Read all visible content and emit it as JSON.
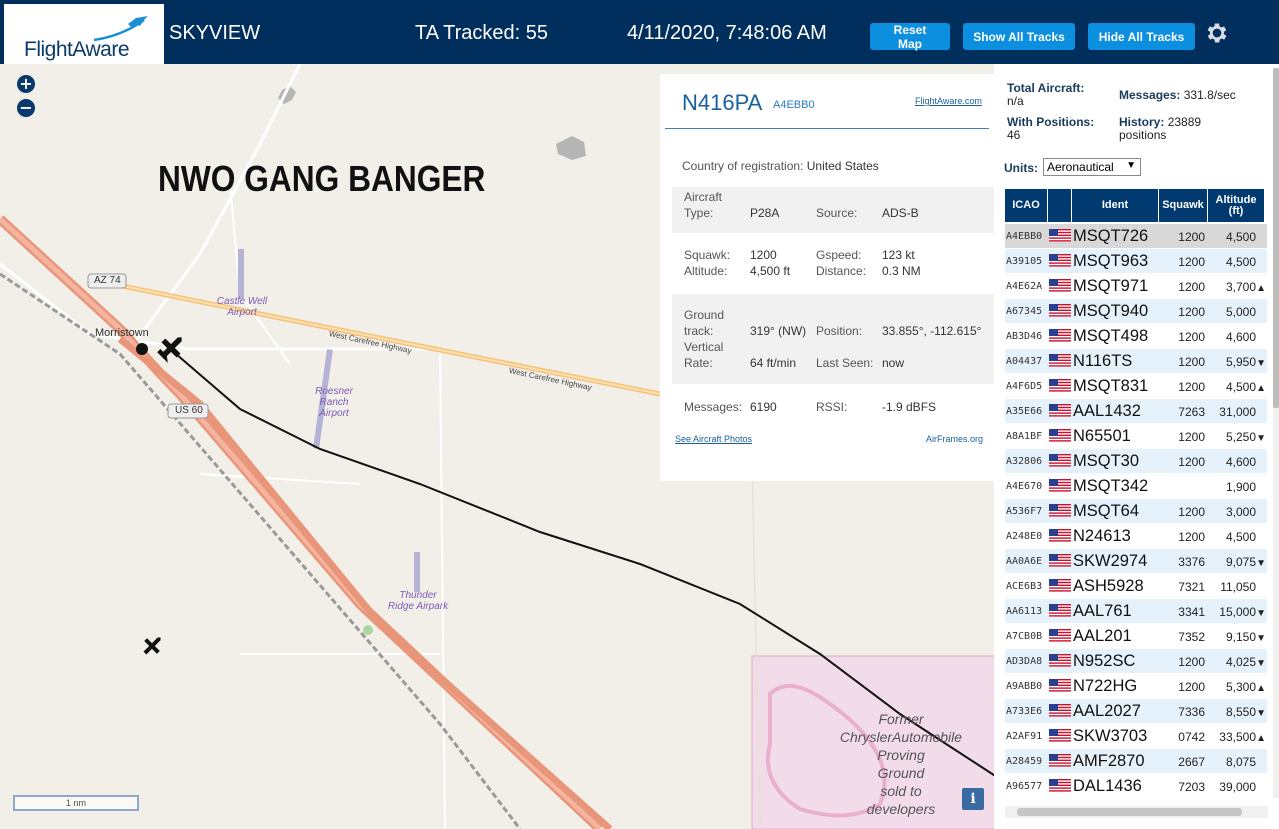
{
  "header": {
    "logo": "FlightAware",
    "app_title": "SKYVIEW",
    "ta_tracked": "TA Tracked: 55",
    "clock": "4/11/2020, 7:48:06 AM",
    "reset_label": "Reset Map",
    "show_all_label": "Show All Tracks",
    "hide_all_label": "Hide All Tracks",
    "settings_icon": "gear-icon"
  },
  "map": {
    "zoom_in": "+",
    "zoom_out": "−",
    "overlay_text": "NWO GANG BANGER",
    "place_morristown": "Morristown",
    "road_az74": "AZ 74",
    "road_us60": "US 60",
    "road_carefree_1": "West Carefree Highway",
    "road_carefree_2": "West Carefree Highway",
    "airport_castle_well": "Castle Well\nAirport",
    "airport_roesner": "Roesner\nRanch\nAirport",
    "airport_thunder": "Thunder\nRidge Airpark",
    "former_text": "Former\nChryslerAutomobile\nProving\nGround\nsold to\ndevelopers",
    "scale": "1 nm",
    "info_button": "i"
  },
  "selected_aircraft": {
    "callsign": "N416PA",
    "hex": "A4EBB0",
    "fa_link": "FlightAware.com",
    "country_label": "Country of registration:",
    "country": "United States",
    "aircraft_label": "Aircraft",
    "type_label": "Type:",
    "type": "P28A",
    "source_label": "Source:",
    "source": "ADS-B",
    "squawk_label": "Squawk:",
    "squawk": "1200",
    "gspeed_label": "Gspeed:",
    "gspeed": "123 kt",
    "altitude_label": "Altitude:",
    "altitude": "4,500 ft",
    "distance_label": "Distance:",
    "distance": "0.3 NM",
    "ground_label": "Ground",
    "track_label": "track:",
    "track": "319° (NW)",
    "position_label": "Position:",
    "position": "33.855°, -112.615°",
    "vertical_label": "Vertical",
    "rate_label": "Rate:",
    "rate": "64 ft/min",
    "last_seen_label": "Last Seen:",
    "last_seen": "now",
    "messages_label": "Messages:",
    "messages": "6190",
    "rssi_label": "RSSI:",
    "rssi": "-1.9 dBFS",
    "photos_link": "See Aircraft Photos",
    "airframes_link": "AirFrames.org"
  },
  "stats": {
    "total_label": "Total Aircraft:",
    "total_value": "n/a",
    "messages_label": "Messages:",
    "messages_value": "331.8/sec",
    "positions_label": "With Positions:",
    "positions_value": "46",
    "history_label": "History:",
    "history_value": "23889",
    "history_unit": "positions",
    "units_label": "Units:",
    "units_value": "Aeronautical"
  },
  "table": {
    "headers": {
      "icao": "ICAO",
      "ident": "Ident",
      "squawk": "Squawk",
      "altitude": "Altitude\n(ft)"
    },
    "rows": [
      {
        "icao": "A4EBB0",
        "ident": "MSQT726",
        "squawk": "1200",
        "alt": "4,500",
        "arrow": ""
      },
      {
        "icao": "A39105",
        "ident": "MSQT963",
        "squawk": "1200",
        "alt": "4,500",
        "arrow": ""
      },
      {
        "icao": "A4E62A",
        "ident": "MSQT971",
        "squawk": "1200",
        "alt": "3,700",
        "arrow": "▲"
      },
      {
        "icao": "A67345",
        "ident": "MSQT940",
        "squawk": "1200",
        "alt": "5,000",
        "arrow": ""
      },
      {
        "icao": "AB3D46",
        "ident": "MSQT498",
        "squawk": "1200",
        "alt": "4,600",
        "arrow": ""
      },
      {
        "icao": "A04437",
        "ident": "N116TS",
        "squawk": "1200",
        "alt": "5,950",
        "arrow": "▼"
      },
      {
        "icao": "A4F6D5",
        "ident": "MSQT831",
        "squawk": "1200",
        "alt": "4,500",
        "arrow": "▲"
      },
      {
        "icao": "A35E66",
        "ident": "AAL1432",
        "squawk": "7263",
        "alt": "31,000",
        "arrow": ""
      },
      {
        "icao": "A8A1BF",
        "ident": "N65501",
        "squawk": "1200",
        "alt": "5,250",
        "arrow": "▼"
      },
      {
        "icao": "A32806",
        "ident": "MSQT30",
        "squawk": "1200",
        "alt": "4,600",
        "arrow": ""
      },
      {
        "icao": "A4E670",
        "ident": "MSQT342",
        "squawk": "",
        "alt": "1,900",
        "arrow": ""
      },
      {
        "icao": "A536F7",
        "ident": "MSQT64",
        "squawk": "1200",
        "alt": "3,000",
        "arrow": ""
      },
      {
        "icao": "A248E0",
        "ident": "N24613",
        "squawk": "1200",
        "alt": "4,500",
        "arrow": ""
      },
      {
        "icao": "AA0A6E",
        "ident": "SKW2974",
        "squawk": "3376",
        "alt": "9,075",
        "arrow": "▼"
      },
      {
        "icao": "ACE6B3",
        "ident": "ASH5928",
        "squawk": "7321",
        "alt": "11,050",
        "arrow": ""
      },
      {
        "icao": "AA6113",
        "ident": "AAL761",
        "squawk": "3341",
        "alt": "15,000",
        "arrow": "▼"
      },
      {
        "icao": "A7CB0B",
        "ident": "AAL201",
        "squawk": "7352",
        "alt": "9,150",
        "arrow": "▼"
      },
      {
        "icao": "AD3DA8",
        "ident": "N952SC",
        "squawk": "1200",
        "alt": "4,025",
        "arrow": "▼"
      },
      {
        "icao": "A9ABB0",
        "ident": "N722HG",
        "squawk": "1200",
        "alt": "5,300",
        "arrow": "▲"
      },
      {
        "icao": "A733E6",
        "ident": "AAL2027",
        "squawk": "7336",
        "alt": "8,550",
        "arrow": "▼"
      },
      {
        "icao": "A2AF91",
        "ident": "SKW3703",
        "squawk": "0742",
        "alt": "33,500",
        "arrow": "▲"
      },
      {
        "icao": "A28459",
        "ident": "AMF2870",
        "squawk": "2667",
        "alt": "8,075",
        "arrow": ""
      },
      {
        "icao": "A96577",
        "ident": "DAL1436",
        "squawk": "7203",
        "alt": "39,000",
        "arrow": ""
      }
    ]
  },
  "colors": {
    "header_bg": "#002f5d",
    "button_blue": "#0d8fe0",
    "table_header": "#003a70",
    "row_alt": "#e6f2fb",
    "highway": "#e8957a",
    "track_line": "#111111"
  }
}
